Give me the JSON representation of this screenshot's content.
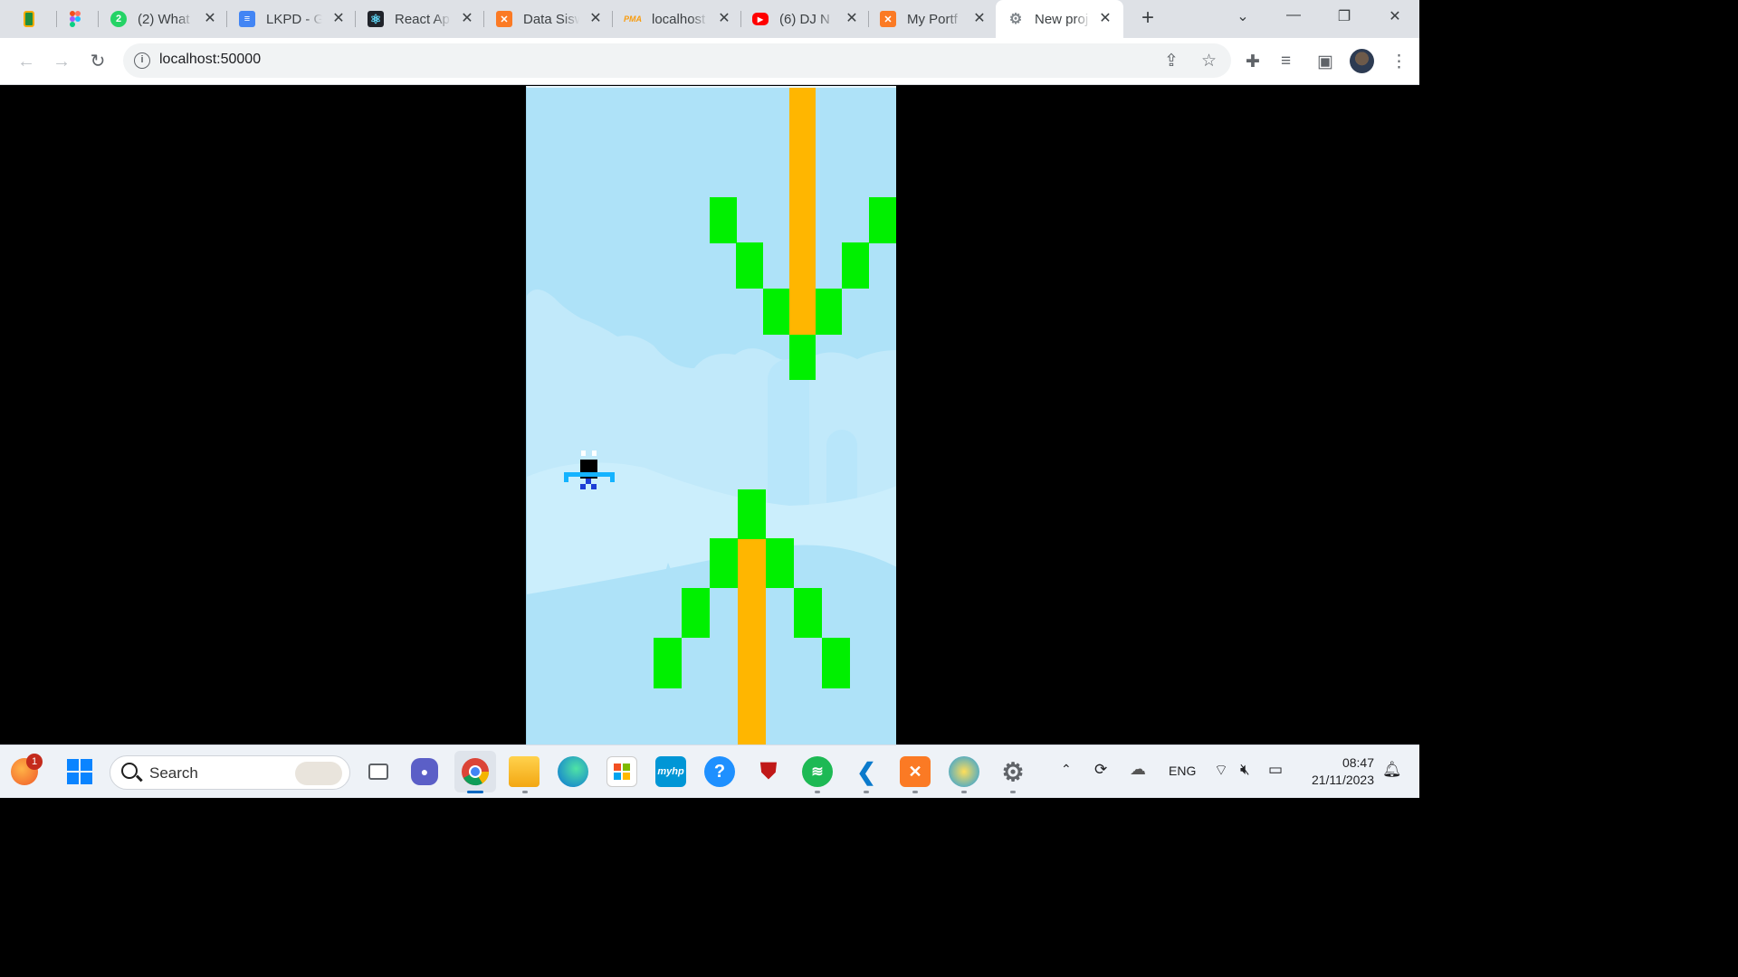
{
  "browser": {
    "tabs": [
      {
        "title": "",
        "icon": "classroom-icon",
        "color": "#f9ab00"
      },
      {
        "title": "",
        "icon": "figma-icon",
        "color": "#f24e1e"
      },
      {
        "title": "(2) What",
        "icon": "whatsapp-icon",
        "color": "#25d366"
      },
      {
        "title": "LKPD - G",
        "icon": "google-docs-icon",
        "color": "#4285f4"
      },
      {
        "title": "React Ap",
        "icon": "react-icon",
        "color": "#20232a"
      },
      {
        "title": "Data Sisw",
        "icon": "xampp-icon",
        "color": "#fb7a24"
      },
      {
        "title": "localhost",
        "icon": "phpmyadmin-icon",
        "color": "#f89c0e"
      },
      {
        "title": "(6) DJ N",
        "icon": "youtube-icon",
        "color": "#ff0000"
      },
      {
        "title": "My Portf",
        "icon": "xampp-icon",
        "color": "#fb7a24"
      },
      {
        "title": "New proj",
        "icon": "settings-gear-icon",
        "color": "#9aa0a6"
      }
    ],
    "url": "localhost:50000"
  },
  "taskbar": {
    "search_placeholder": "Search",
    "notification_count": "1",
    "language": "ENG",
    "time": "08:47",
    "date": "21/11/2023",
    "apps": [
      "task-view-icon",
      "teams-chat-icon",
      "chrome-icon",
      "file-explorer-icon",
      "edge-icon",
      "microsoft-store-icon",
      "myhp-icon",
      "get-help-icon",
      "mcafee-icon",
      "spotify-icon",
      "vscode-icon",
      "xampp-icon",
      "paint-icon",
      "settings-icon"
    ],
    "myhp_label": "myhp"
  },
  "game": {
    "colors": {
      "sky": "#aee2f8",
      "pipe": "#ffb600",
      "leaf": "#00f000",
      "bird_body": "#000000",
      "bird_wing": "#14b3ff"
    }
  }
}
